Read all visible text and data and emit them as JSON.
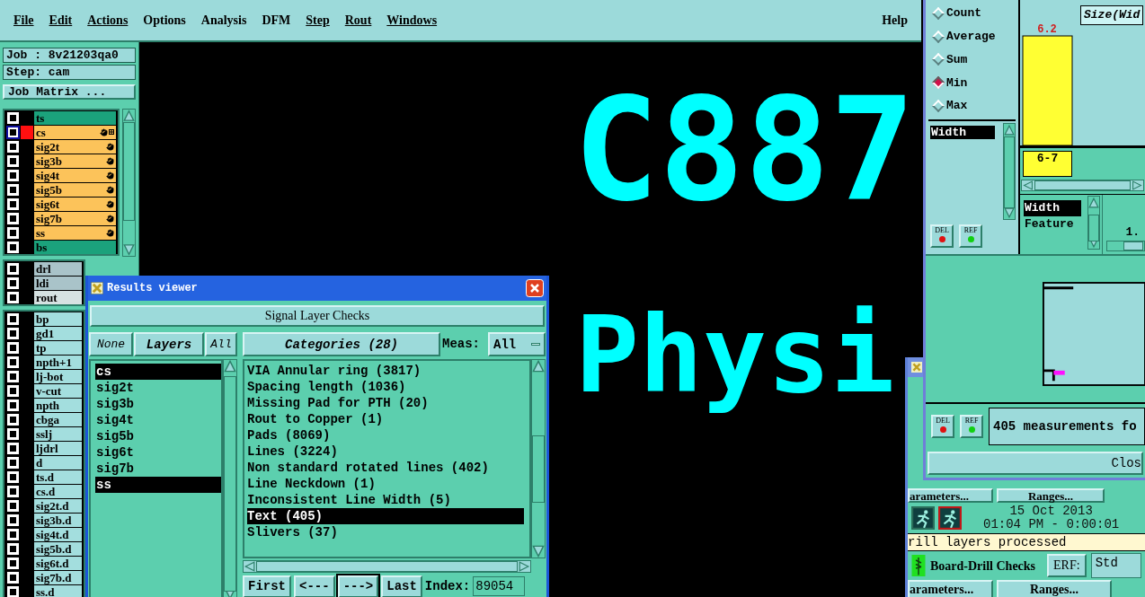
{
  "menu": [
    {
      "label": "File",
      "underlined": true
    },
    {
      "label": "Edit",
      "underlined": true
    },
    {
      "label": "Actions",
      "underlined": true
    },
    {
      "label": "Options",
      "underlined": false
    },
    {
      "label": "Analysis",
      "underlined": false
    },
    {
      "label": "DFM",
      "underlined": false
    },
    {
      "label": "Step",
      "underlined": true
    },
    {
      "label": "Rout",
      "underlined": true
    },
    {
      "label": "Windows",
      "underlined": true
    }
  ],
  "help": "Help",
  "job_label": "Job : 8v21203qa0",
  "step_label": "Step: cam",
  "job_matrix_button": "Job Matrix ...",
  "layer_groups": [
    {
      "layers": [
        {
          "name": "ts",
          "color": "#1ba27c",
          "checked": true,
          "selected": false,
          "affected": false
        },
        {
          "name": "cs",
          "color": "#fcc35a",
          "checked": true,
          "selected": true,
          "affected": true
        },
        {
          "name": "sig2t",
          "color": "#fcc35a",
          "checked": true,
          "selected": false,
          "affected": true
        },
        {
          "name": "sig3b",
          "color": "#fcc35a",
          "checked": true,
          "selected": false,
          "affected": true
        },
        {
          "name": "sig4t",
          "color": "#fcc35a",
          "checked": true,
          "selected": false,
          "affected": true
        },
        {
          "name": "sig5b",
          "color": "#fcc35a",
          "checked": true,
          "selected": false,
          "affected": true
        },
        {
          "name": "sig6t",
          "color": "#fcc35a",
          "checked": true,
          "selected": false,
          "affected": true
        },
        {
          "name": "sig7b",
          "color": "#fcc35a",
          "checked": true,
          "selected": false,
          "affected": true
        },
        {
          "name": "ss",
          "color": "#fcc35a",
          "checked": true,
          "selected": false,
          "affected": true
        },
        {
          "name": "bs",
          "color": "#1ba27c",
          "checked": true,
          "selected": false,
          "affected": false
        }
      ]
    },
    {
      "layers": [
        {
          "name": "drl",
          "color": "#a9c3c9",
          "checked": true,
          "selected": false,
          "affected": false
        },
        {
          "name": "ldi",
          "color": "#a9c3c9",
          "checked": true,
          "selected": false,
          "affected": false
        },
        {
          "name": "rout",
          "color": "#d6e2e2",
          "checked": true,
          "selected": false,
          "affected": false
        }
      ]
    },
    {
      "layers": [
        {
          "name": "bp",
          "color": "#a3dede",
          "checked": true,
          "selected": false,
          "affected": false
        },
        {
          "name": "gd1",
          "color": "#a3dede",
          "checked": true,
          "selected": false,
          "affected": false
        },
        {
          "name": "tp",
          "color": "#a3dede",
          "checked": true,
          "selected": false,
          "affected": false
        },
        {
          "name": "npth+1",
          "color": "#a3dede",
          "checked": true,
          "selected": false,
          "affected": false
        },
        {
          "name": "lj-bot",
          "color": "#a3dede",
          "checked": true,
          "selected": false,
          "affected": false
        },
        {
          "name": "v-cut",
          "color": "#a3dede",
          "checked": true,
          "selected": false,
          "affected": false
        },
        {
          "name": "npth",
          "color": "#a3dede",
          "checked": true,
          "selected": false,
          "affected": false
        },
        {
          "name": "cbga",
          "color": "#a3dede",
          "checked": true,
          "selected": false,
          "affected": false
        },
        {
          "name": "sslj",
          "color": "#a3dede",
          "checked": true,
          "selected": false,
          "affected": false
        },
        {
          "name": "ljdrl",
          "color": "#a3dede",
          "checked": true,
          "selected": false,
          "affected": false
        },
        {
          "name": "d",
          "color": "#a3dede",
          "checked": true,
          "selected": false,
          "affected": false
        },
        {
          "name": "ts.d",
          "color": "#a3dede",
          "checked": true,
          "selected": false,
          "affected": false
        },
        {
          "name": "cs.d",
          "color": "#a3dede",
          "checked": true,
          "selected": false,
          "affected": false
        },
        {
          "name": "sig2t.d",
          "color": "#a3dede",
          "checked": true,
          "selected": false,
          "affected": false
        },
        {
          "name": "sig3b.d",
          "color": "#a3dede",
          "checked": true,
          "selected": false,
          "affected": false
        },
        {
          "name": "sig4t.d",
          "color": "#a3dede",
          "checked": true,
          "selected": false,
          "affected": false
        },
        {
          "name": "sig5b.d",
          "color": "#a3dede",
          "checked": true,
          "selected": false,
          "affected": false
        },
        {
          "name": "sig6t.d",
          "color": "#a3dede",
          "checked": true,
          "selected": false,
          "affected": false
        },
        {
          "name": "sig7b.d",
          "color": "#a3dede",
          "checked": true,
          "selected": false,
          "affected": false
        },
        {
          "name": "ss.d",
          "color": "#a3dede",
          "checked": true,
          "selected": false,
          "affected": false
        }
      ]
    }
  ],
  "canvas": {
    "texts": [
      "C887",
      "Physi"
    ]
  },
  "results_viewer": {
    "title": "Results viewer",
    "heading": "Signal Layer Checks",
    "none_button": "None",
    "layers_button": "Layers",
    "all_button": "All",
    "layers": [
      {
        "name": "cs",
        "selected": true
      },
      {
        "name": "sig2t",
        "selected": false
      },
      {
        "name": "sig3b",
        "selected": false
      },
      {
        "name": "sig4t",
        "selected": false
      },
      {
        "name": "sig5b",
        "selected": false
      },
      {
        "name": "sig6t",
        "selected": false
      },
      {
        "name": "sig7b",
        "selected": false
      },
      {
        "name": "ss",
        "selected": true
      }
    ],
    "categories_button": "Categories (28)",
    "meas_label": "Meas:",
    "meas_value": "All",
    "categories": [
      {
        "label": "VIA Annular ring (3817)",
        "selected": false
      },
      {
        "label": "Spacing length (1036)",
        "selected": false
      },
      {
        "label": "Missing Pad for PTH (20)",
        "selected": false
      },
      {
        "label": "Rout to Copper (1)",
        "selected": false
      },
      {
        "label": "Pads (8069)",
        "selected": false
      },
      {
        "label": "Lines (3224)",
        "selected": false
      },
      {
        "label": "Non standard rotated lines (402)",
        "selected": false
      },
      {
        "label": "Line Neckdown (1)",
        "selected": false
      },
      {
        "label": "Inconsistent Line Width (5)",
        "selected": false
      },
      {
        "label": "Text (405)",
        "selected": true
      },
      {
        "label": "Slivers (37)",
        "selected": false
      }
    ],
    "nav_buttons": [
      {
        "label": "First",
        "focused": false
      },
      {
        "label": "<---",
        "focused": false
      },
      {
        "label": "--->",
        "focused": true
      },
      {
        "label": "Last",
        "focused": false
      }
    ],
    "index_label": "Index:",
    "index_value": "89054"
  },
  "stats_window": {
    "modes": [
      {
        "label": "Count",
        "selected": false
      },
      {
        "label": "Average",
        "selected": false
      },
      {
        "label": "Sum",
        "selected": false
      },
      {
        "label": "Min",
        "selected": true
      },
      {
        "label": "Max",
        "selected": false
      }
    ],
    "fields": [
      {
        "label": "Width",
        "selected": true
      }
    ],
    "del_button": "DEL",
    "ref_button": "REF",
    "chart_data": {
      "type": "bar",
      "title": "Size(Wid",
      "categories": [
        "6-7"
      ],
      "series": [
        {
          "color": "#ffff33",
          "values": [
            6.2
          ]
        }
      ],
      "data_labels": true
    },
    "features": [
      {
        "label": "Width",
        "selected": true
      },
      {
        "label": "Feature",
        "selected": false
      }
    ],
    "reading": "1.",
    "preview_del_button": "DEL",
    "preview_ref_button": "REF",
    "summary": "405 measurements fo",
    "close_button": "Clos"
  },
  "checks_window": {
    "top_buttons": [
      "arameters...",
      "Ranges..."
    ],
    "date": "15 Oct 2013",
    "time": "01:04 PM - 0:00:01",
    "status": "rill layers processed",
    "check_name": "Board-Drill Checks",
    "erf_label": "ERF:",
    "erf_value": "Std",
    "bottom_buttons": [
      "arameters...",
      "Ranges..."
    ]
  }
}
